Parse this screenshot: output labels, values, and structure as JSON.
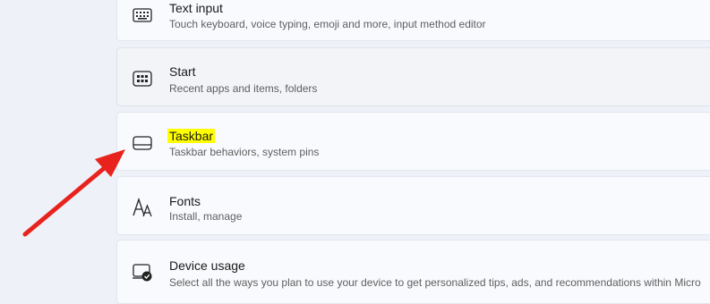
{
  "settings_items": [
    {
      "icon": "keyboard-icon",
      "title": "Text input",
      "subtitle": "Touch keyboard, voice typing, emoji and more, input method editor"
    },
    {
      "icon": "start-menu-icon",
      "title": "Start",
      "subtitle": "Recent apps and items, folders"
    },
    {
      "icon": "taskbar-icon",
      "title": "Taskbar",
      "subtitle": "Taskbar behaviors, system pins"
    },
    {
      "icon": "fonts-icon",
      "title": "Fonts",
      "subtitle": "Install, manage"
    },
    {
      "icon": "device-usage-icon",
      "title": "Device usage",
      "subtitle": "Select all the ways you plan to use your device to get personalized tips, ads, and recommendations within Micro"
    }
  ],
  "annotation": {
    "arrow_color": "#e8231d",
    "highlight_color": "#ffff00",
    "target": "Taskbar"
  }
}
